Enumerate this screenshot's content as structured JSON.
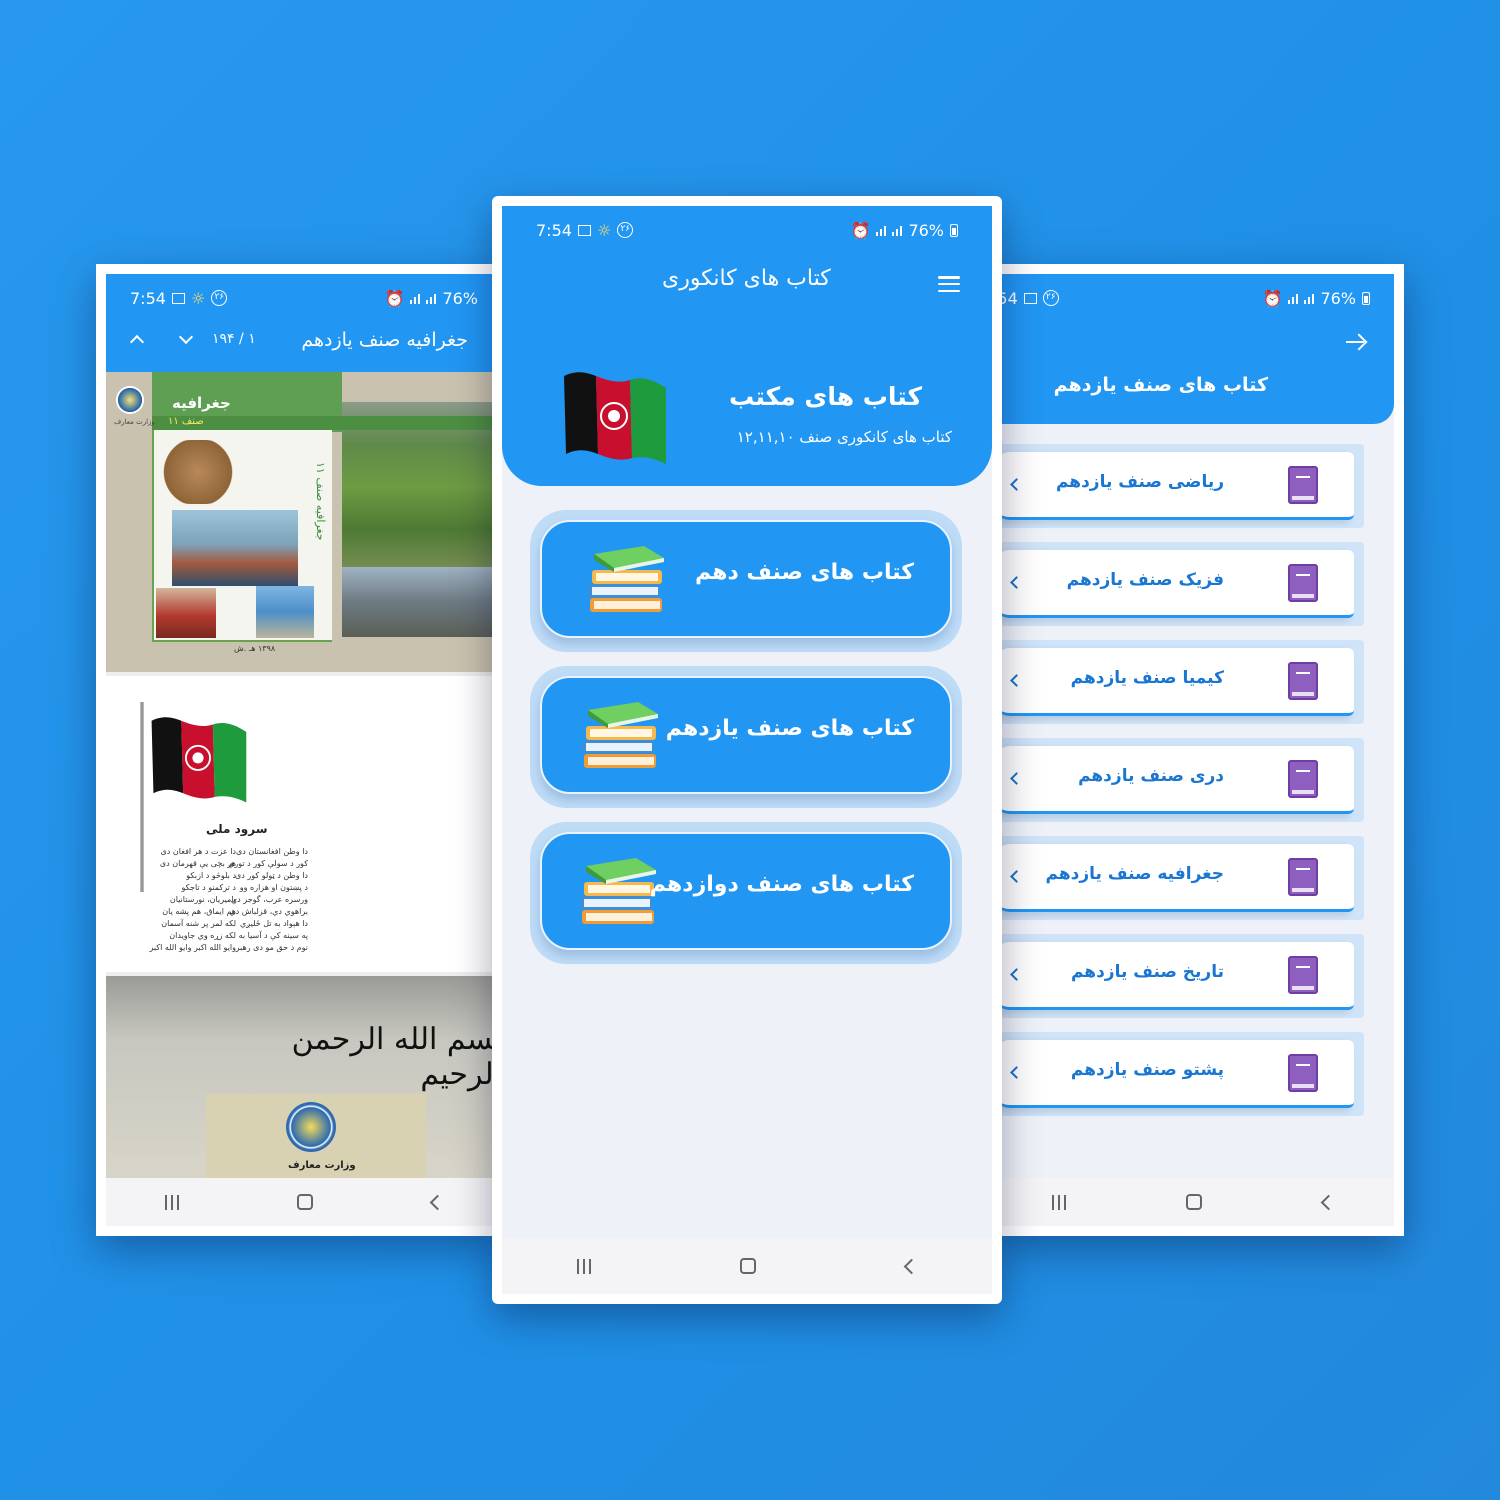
{
  "status": {
    "time": "7:54",
    "battery": "76%",
    "badge": "۲۶"
  },
  "left_screen": {
    "title": "جغرافیه صنف یازدهم",
    "page_count": "۱ / ۱۹۴",
    "cover": {
      "subject": "جغرافیه",
      "grade": "صنف ۱۱",
      "vertical": "جغرافیه صنف ۱۱",
      "year": "۱۳۹۸ هـ .ش",
      "ministry_logo_label": "وزارت معارف"
    },
    "anthem": {
      "title": "سرود ملی",
      "col_right": "دا وطن افغانستان دی\nكور د سولې كور د توري\nدا وطن د ټولو كور دی\nد پښتون او هزاره وو\nورسره عرب، گوجر دي\nبراهوي دي، قزلباش دي\nدا هېواد به تل ځلیږي\nپه سینه كې د آسیا به\nنوم د حق مو دی رهبر",
      "col_left": "دا عزت د هر افغان دی\nهر بچی یې قهرمان دی\nد بلوڅو د ازبكو\nد تركمنو د تاجكو\nپامیریان، نورستانیان\nهم ایماق، هم پشه یان\nلكه لمر پر شنه آسمان\nلكه زړه وي جاویدان\nوایو الله اكبر وایو الله اكبر"
    },
    "basmala": "بسم الله الرحمن الرحیم",
    "ministry": "وزارت معارف"
  },
  "center_screen": {
    "app_title": "کتاب های کانکوری",
    "hero_title": "کتاب های مکتب",
    "hero_subtitle": "کتاب های کانکوری صنف ۱۲,۱۱,۱۰",
    "grades": [
      {
        "label": "کتاب های صنف دهم"
      },
      {
        "label": "کتاب های صنف یازدهم"
      },
      {
        "label": "کتاب های صنف دوازدهم"
      }
    ]
  },
  "right_screen": {
    "title": "کتاب های  صنف یازدهم",
    "books": [
      {
        "label": "ریاضی صنف یازدهم"
      },
      {
        "label": "فزیک صنف یازدهم"
      },
      {
        "label": "کیمیا صنف یازدهم"
      },
      {
        "label": "دری صنف یازدهم"
      },
      {
        "label": "جغرافیه صنف یازدهم"
      },
      {
        "label": "تاریخ صنف یازدهم"
      },
      {
        "label": "پشتو صنف یازدهم"
      }
    ]
  }
}
